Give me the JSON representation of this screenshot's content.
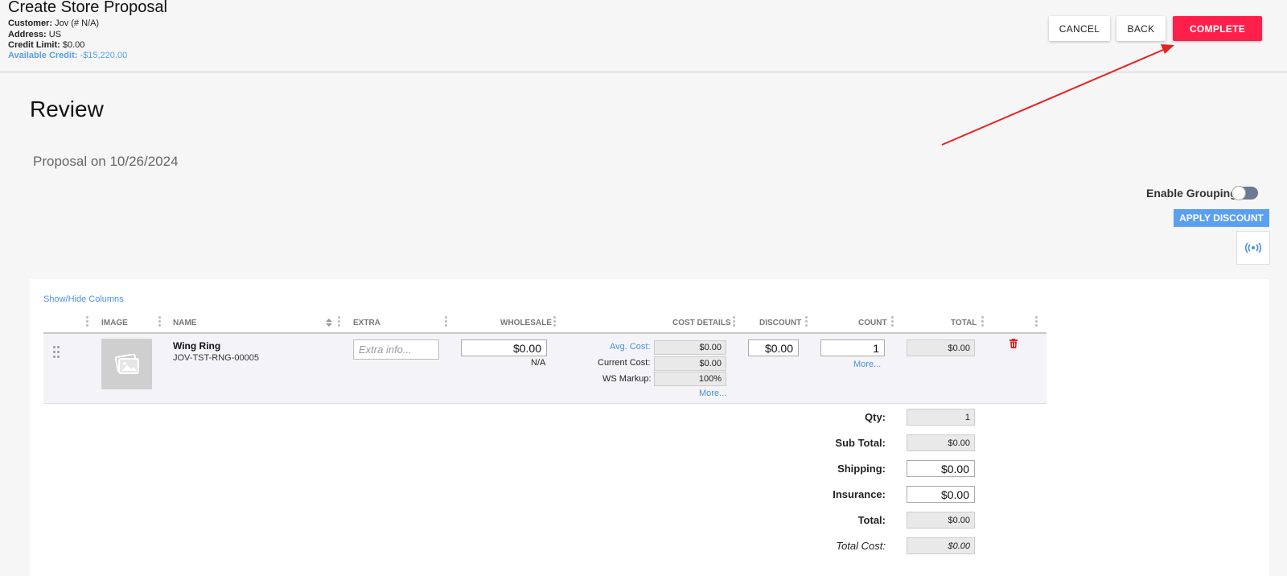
{
  "header": {
    "title": "Create Store Proposal",
    "customer_label": "Customer:",
    "customer_value": "Jov (# N/A)",
    "address_label": "Address:",
    "address_value": "US",
    "credit_limit_label": "Credit Limit:",
    "credit_limit_value": "$0.00",
    "available_credit_label": "Available Credit:",
    "available_credit_value": "-$15,220.00",
    "cancel_label": "CANCEL",
    "back_label": "BACK",
    "complete_label": "COMPLETE"
  },
  "colors": {
    "complete": "#ff1f4b",
    "link": "#4a90e2",
    "apply": "#5a9ff0",
    "annotation_arrow": "#e8201f"
  },
  "review": {
    "heading": "Review",
    "proposal_date": "Proposal on 10/26/2024",
    "grouping_label": "Enable Grouping",
    "grouping_enabled": false,
    "apply_discount_label": "APPLY DISCOUNT",
    "broadcast_icon": "broadcast-icon"
  },
  "table": {
    "show_hide_label": "Show/Hide Columns",
    "columns": [
      "IMAGE",
      "NAME",
      "EXTRA",
      "WHOLESALE",
      "COST DETAILS",
      "DISCOUNT",
      "COUNT",
      "TOTAL"
    ],
    "row": {
      "name": "Wing Ring",
      "sku": "JOV-TST-RNG-00005",
      "extra_placeholder": "Extra info...",
      "wholesale_value": "$0.00",
      "wholesale_sub": "N/A",
      "avg_cost_label": "Avg. Cost:",
      "avg_cost_value": "$0.00",
      "current_cost_label": "Current Cost:",
      "current_cost_value": "$0.00",
      "ws_markup_label": "WS Markup:",
      "ws_markup_value": "100%",
      "cost_more_label": "More...",
      "discount_value": "$0.00",
      "count_value": "1",
      "count_more_label": "More...",
      "total_value": "$0.00"
    }
  },
  "summary": {
    "qty_label": "Qty:",
    "qty_value": "1",
    "subtotal_label": "Sub Total:",
    "subtotal_value": "$0.00",
    "shipping_label": "Shipping:",
    "shipping_value": "$0.00",
    "insurance_label": "Insurance:",
    "insurance_value": "$0.00",
    "total_label": "Total:",
    "total_value": "$0.00",
    "total_cost_label": "Total Cost:",
    "total_cost_value": "$0.00"
  }
}
